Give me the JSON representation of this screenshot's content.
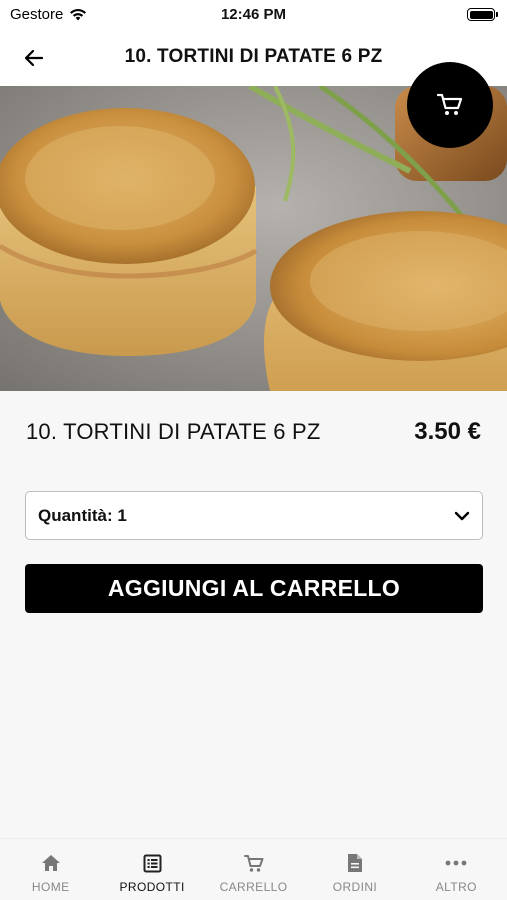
{
  "status_bar": {
    "carrier": "Gestore",
    "time": "12:46 PM"
  },
  "header": {
    "title": "10. TORTINI DI PATATE 6 PZ",
    "back_icon": "arrow-left-icon"
  },
  "cart_fab": {
    "icon": "cart-icon"
  },
  "product": {
    "name": "10. TORTINI DI PATATE 6 PZ",
    "price": "3.50 €"
  },
  "quantity": {
    "label": "Quantità: 1",
    "icon": "chevron-down-icon"
  },
  "add_button": {
    "label": "AGGIUNGI AL CARRELLO"
  },
  "bottom_nav": {
    "items": [
      {
        "label": "HOME",
        "icon": "home-icon"
      },
      {
        "label": "PRODOTTI",
        "icon": "list-icon",
        "active": true
      },
      {
        "label": "CARRELLO",
        "icon": "cart-icon"
      },
      {
        "label": "ORDINI",
        "icon": "document-icon"
      },
      {
        "label": "ALTRO",
        "icon": "more-icon"
      }
    ]
  },
  "colors": {
    "accent": "#000000",
    "background": "#f7f7f7",
    "inactive": "#888888"
  }
}
